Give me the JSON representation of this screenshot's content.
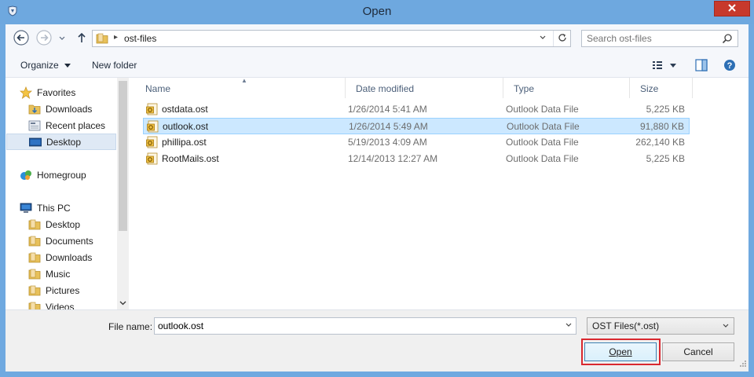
{
  "window": {
    "title": "Open",
    "app_icon": "shield-icon",
    "close_icon": "close-icon"
  },
  "navbar": {
    "back_icon": "back-arrow-icon",
    "forward_icon": "forward-arrow-icon",
    "up_icon": "up-arrow-icon",
    "address": {
      "crumb": "ost-files",
      "folder_icon": "folder-icon"
    },
    "search": {
      "placeholder": "Search ost-files"
    }
  },
  "toolbar": {
    "organize_label": "Organize",
    "new_folder_label": "New folder"
  },
  "nav_pane": {
    "items": [
      {
        "label": "Favorites",
        "icon": "star-icon"
      },
      {
        "label": "Downloads",
        "icon": "downloads-folder-icon"
      },
      {
        "label": "Recent places",
        "icon": "recent-places-icon"
      },
      {
        "label": "Desktop",
        "icon": "desktop-icon",
        "selected": true
      },
      {
        "label": "Homegroup",
        "icon": "homegroup-icon"
      },
      {
        "label": "This PC",
        "icon": "computer-icon"
      },
      {
        "label": "Desktop",
        "icon": "folder-icon"
      },
      {
        "label": "Documents",
        "icon": "folder-icon"
      },
      {
        "label": "Downloads",
        "icon": "folder-icon"
      },
      {
        "label": "Music",
        "icon": "folder-icon"
      },
      {
        "label": "Pictures",
        "icon": "folder-icon"
      },
      {
        "label": "Videos",
        "icon": "folder-icon"
      }
    ]
  },
  "file_list": {
    "columns": [
      "Name",
      "Date modified",
      "Type",
      "Size"
    ],
    "rows": [
      {
        "name": "ostdata.ost",
        "date": "1/26/2014 5:41 AM",
        "type": "Outlook Data File",
        "size": "5,225 KB"
      },
      {
        "name": "outlook.ost",
        "date": "1/26/2014 5:49 AM",
        "type": "Outlook Data File",
        "size": "91,880 KB",
        "selected": true
      },
      {
        "name": "phillipa.ost",
        "date": "5/19/2013 4:09 AM",
        "type": "Outlook Data File",
        "size": "262,140 KB"
      },
      {
        "name": "RootMails.ost",
        "date": "12/14/2013 12:27 AM",
        "type": "Outlook Data File",
        "size": "5,225 KB"
      }
    ]
  },
  "bottom": {
    "file_name_label": "File name:",
    "file_name_value": "outlook.ost",
    "file_type": "OST Files(*.ost)",
    "open_label": "Open",
    "cancel_label": "Cancel"
  },
  "colors": {
    "title_bar": "#6ea8df",
    "close_button": "#c7392c",
    "selection": "#cce8ff",
    "highlight_border": "#d9282f"
  }
}
